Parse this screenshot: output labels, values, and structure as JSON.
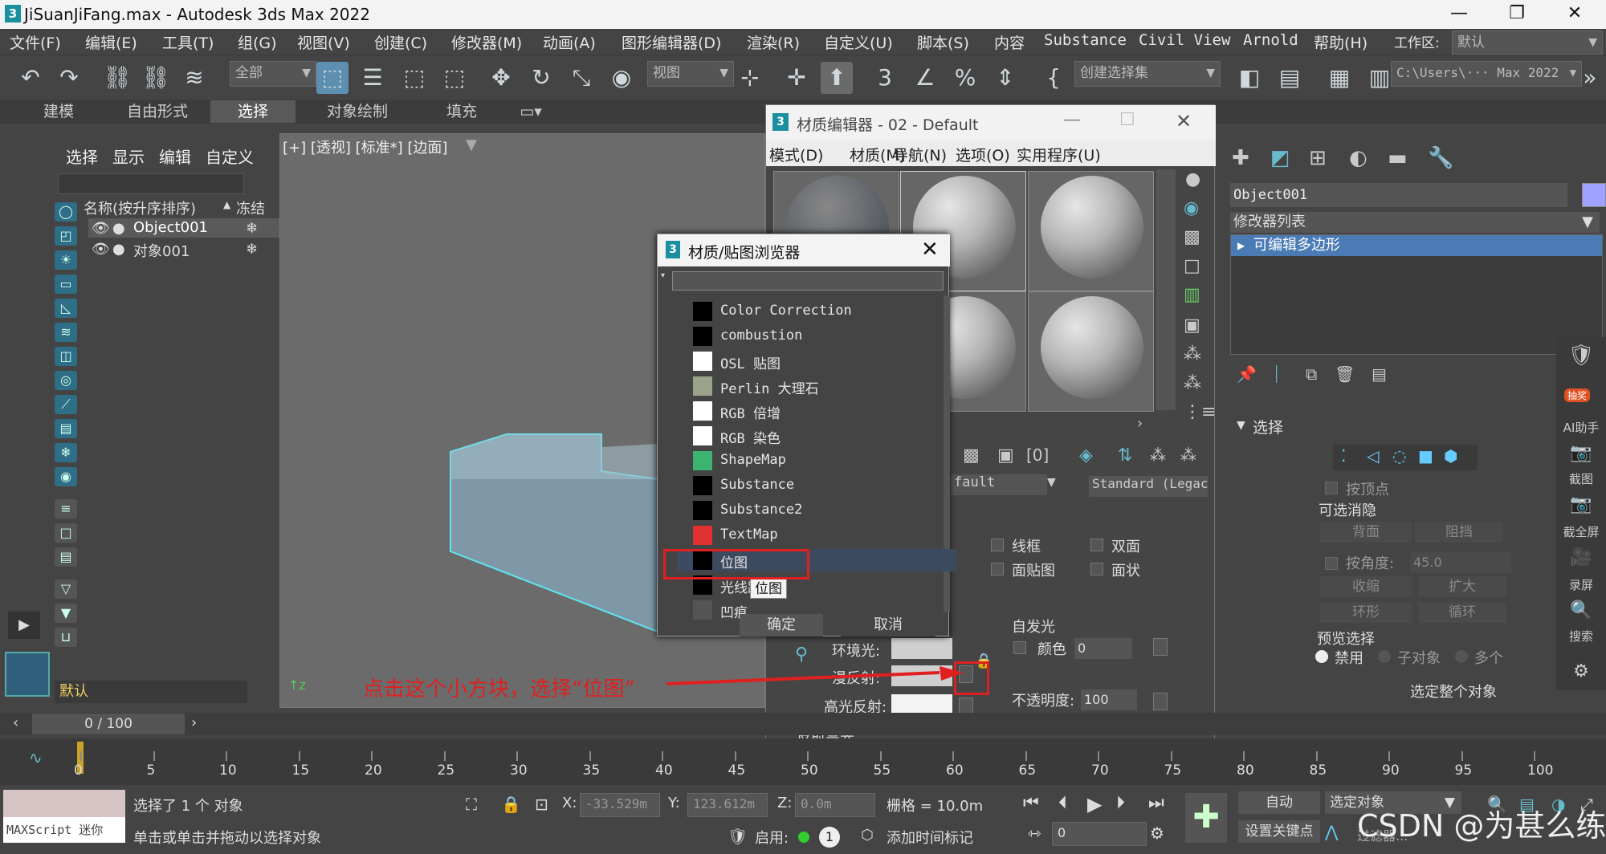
{
  "window": {
    "title": "JiSuanJiFang.max - Autodesk 3ds Max 2022",
    "controls": [
      "—",
      "❐",
      "✕"
    ]
  },
  "menu": [
    "文件(F)",
    "编辑(E)",
    "工具(T)",
    "组(G)",
    "视图(V)",
    "创建(C)",
    "修改器(M)",
    "动画(A)",
    "图形编辑器(D)",
    "渲染(R)",
    "自定义(U)",
    "脚本(S)",
    "内容",
    "Substance",
    "Civil View",
    "Arnold",
    "帮助(H)"
  ],
  "workspace": {
    "label": "工作区:",
    "value": "默认"
  },
  "toolbar": {
    "filter_value": "全部",
    "ref_coord": "视图",
    "selection_set": "创建选择集",
    "path": "C:\\Users\\··· Max 2022"
  },
  "ribbon_tabs": [
    "建模",
    "自由形式",
    "选择",
    "对象绘制",
    "填充"
  ],
  "explorer": {
    "menu": [
      "选择",
      "显示",
      "编辑",
      "自定义"
    ],
    "col_name": "名称(按升序排序)",
    "col_freeze": "冻结",
    "rows": [
      "Object001",
      "对象001"
    ],
    "layer": "默认"
  },
  "viewport": {
    "label": "[+] [透视] [标准*] [边面]"
  },
  "material_editor": {
    "title": "材质编辑器 - 02 - Default",
    "menu": [
      "模式(D)",
      "材质(M)",
      "导航(N)",
      "选项(O)",
      "实用程序(U)"
    ],
    "name_partial": "fault",
    "type": "Standard (Legac",
    "options": [
      "线框",
      "双面",
      "面贴图",
      "面状"
    ],
    "ambient_label": "环境光:",
    "diffuse_label": "漫反射:",
    "specular_label": "高光反射:",
    "self_illum": "自发光",
    "color_label": "颜色",
    "color_value": "0",
    "opacity_label": "不透明度:",
    "opacity_value": "100",
    "reflect_hl": "反射高光"
  },
  "browser": {
    "title": "材质/贴图浏览器",
    "items": [
      {
        "label": "Color Correction",
        "swatch": "#000000"
      },
      {
        "label": "combustion",
        "swatch": "#000000"
      },
      {
        "label": "OSL 贴图",
        "swatch": "#ffffff"
      },
      {
        "label": "Perlin 大理石",
        "swatch": "#9aa38a"
      },
      {
        "label": "RGB 倍增",
        "swatch": "#ffffff"
      },
      {
        "label": "RGB 染色",
        "swatch": "#ffffff"
      },
      {
        "label": "ShapeMap",
        "swatch": "#3cb371"
      },
      {
        "label": "Substance",
        "swatch": "#000000"
      },
      {
        "label": "Substance2",
        "swatch": "#000000"
      },
      {
        "label": "TextMap",
        "swatch": "#e03030"
      },
      {
        "label": "位图",
        "swatch": "#000000"
      },
      {
        "label": "光线跟",
        "swatch": "#000000"
      },
      {
        "label": "凹痕",
        "swatch": "#555555"
      }
    ],
    "tooltip": "位图",
    "ok": "确定",
    "cancel": "取消"
  },
  "cmdpanel": {
    "object_name": "Object001",
    "modifier_list": "修改器列表",
    "stack_item": "可编辑多边形",
    "rollout": "选择",
    "by_vertex": "按顶点",
    "cull_group": "可选消隐",
    "back": "背面",
    "occluded": "阻挡",
    "by_angle": "按角度:",
    "angle_value": "45.0",
    "shrink": "收缩",
    "grow": "扩大",
    "ring": "环形",
    "loop": "循环",
    "preview": "预览选择",
    "disabled": "禁用",
    "subobj": "子对象",
    "multi": "多个",
    "select_whole": "选定整个对象"
  },
  "right_rail": [
    "AI助手",
    "截图",
    "截全屏",
    "录屏",
    "搜索"
  ],
  "right_badge": "抽奖",
  "timeline": {
    "frame": "0 / 100",
    "ticks": [
      "0",
      "5",
      "10",
      "15",
      "20",
      "25",
      "30",
      "35",
      "40",
      "45",
      "50",
      "55",
      "60",
      "65",
      "70",
      "75",
      "80",
      "85",
      "90",
      "95",
      "100"
    ]
  },
  "status": {
    "maxscript": "MAXScript 迷你",
    "selected": "选择了 1 个 对象",
    "hint": "单击或单击并拖动以选择对象",
    "x_label": "X:",
    "x_value": "-33.529m",
    "y_label": "Y:",
    "y_value": "123.612m",
    "z_label": "Z:",
    "z_value": "0.0m",
    "grid": "栅格 = 10.0m",
    "enable": "启用:",
    "add_time_tag": "添加时间标记",
    "auto": "自动",
    "selected_obj": "选定对象",
    "set_key": "设置关键点",
    "frame_field": "0",
    "filters": "过滤器..."
  },
  "annotation": "点击这个小方块，选择“位图”",
  "watermark": "CSDN @为甚么练"
}
